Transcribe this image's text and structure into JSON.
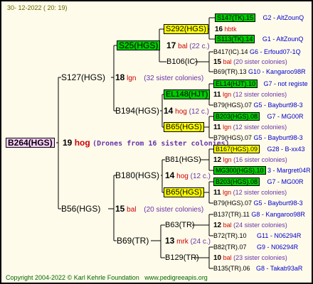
{
  "header": {
    "date": "30-  12-2022  ( 20:  19)"
  },
  "footer": {
    "copyright": "Copyright 2004-2022 © Karl Kehrle Foundation",
    "site": "www.pedigreeapis.org"
  },
  "root": {
    "id": "B264(HGS)",
    "year": "19",
    "breeder": "hog",
    "note": "(Drones from 16 sister colonies)"
  },
  "queens": {
    "q_s127": {
      "id": "S127(HGS)"
    },
    "q_s25": {
      "id": "S25(HGS)"
    },
    "q_s292": {
      "id": "S292(HGS)"
    },
    "q_b106": {
      "id": "B106(IC)"
    },
    "q_b194": {
      "id": "B194(HGS)"
    },
    "q_el148": {
      "id": "EL148(HJT)"
    },
    "q_b65a": {
      "id": "B65(HGS)"
    },
    "q_b56": {
      "id": "B56(HGS)"
    },
    "q_b180": {
      "id": "B180(HGS)"
    },
    "q_b81": {
      "id": "B81(HGS)"
    },
    "q_b65b": {
      "id": "B65(HGS)"
    },
    "q_b69": {
      "id": "B69(TR)"
    },
    "q_b63": {
      "id": "B63(TR)"
    },
    "q_b129": {
      "id": "B129(TR)"
    }
  },
  "mid": {
    "m_s127": {
      "year": "18",
      "breeder": "lgn",
      "note": "(32 sister colonies)"
    },
    "m_s25": {
      "year": "17",
      "breeder": "bal",
      "note": "(22 c.)"
    },
    "m_b194": {
      "year": "14",
      "breeder": "hog",
      "note": "(12 c.)"
    },
    "m_b56": {
      "year": "15",
      "breeder": "bal",
      "note": "(20 sister colonies)"
    },
    "m_b180": {
      "year": "14",
      "breeder": "hog",
      "note": "(12 c.)"
    },
    "m_b69": {
      "year": "13",
      "breeder": "mrk",
      "note": "(24 c.)"
    }
  },
  "leaves": {
    "l1": {
      "id": "S147(TK).15",
      "ref": "G2 - AltZounQ"
    },
    "l2": {
      "year": "16",
      "breeder": "hbtk",
      "note": ""
    },
    "l3": {
      "id": "S113(TK).14",
      "ref": "G1 - AltZounQ"
    },
    "l4": {
      "id": "B417(IC).14",
      "ref": "G6 - Erfoud07-1Q"
    },
    "l5": {
      "year": "15",
      "breeder": "bal",
      "note": "(20 sister colonies)"
    },
    "l6": {
      "id": "B69(TR).13",
      "ref": "G10 - Kangaroo98R"
    },
    "l7": {
      "id": "EL14(HJT).10",
      "ref": "G7 - not registe"
    },
    "l8": {
      "year": "11",
      "breeder": "lgn",
      "note": "(12 sister colonies)"
    },
    "l9": {
      "id": "B79(HGS).07",
      "ref": "G5 - Bayburt98-3"
    },
    "l10": {
      "id": "B203(HGS).08",
      "ref": "G7 - MG00R"
    },
    "l11": {
      "year": "11",
      "breeder": "lgn",
      "note": "(12 sister colonies)"
    },
    "l12": {
      "id": "B79(HGS).07",
      "ref": "G5 - Bayburt98-3"
    },
    "l13": {
      "id": "B167(HGS).09",
      "ref": "G28 - B-xx43"
    },
    "l14": {
      "year": "12",
      "breeder": "lgn",
      "note": "(16 sister colonies)"
    },
    "l15": {
      "id": "MG300(HGS).10",
      "ref": "3 - Margret04R"
    },
    "l16": {
      "id": "B203(HGS).08",
      "ref": "G7 - MG00R"
    },
    "l17": {
      "year": "11",
      "breeder": "lgn",
      "note": "(12 sister colonies)"
    },
    "l18": {
      "id": "B79(HGS).07",
      "ref": "G5 - Bayburt98-3"
    },
    "l19": {
      "id": "B137(TR).11",
      "ref": "G8 - Kangaroo98R"
    },
    "l20": {
      "year": "12",
      "breeder": "bal",
      "note": "(24 sister colonies)"
    },
    "l21": {
      "id": "B72(TR).10",
      "ref": "G11 - N06294R"
    },
    "l22": {
      "id": "B82(TR).07",
      "ref": "G9 - N06294R"
    },
    "l23": {
      "year": "10",
      "breeder": "bal",
      "note": "(23 sister colonies)"
    },
    "l24": {
      "id": "B135(TR).06",
      "ref": "G8 - Takab93aR"
    }
  }
}
